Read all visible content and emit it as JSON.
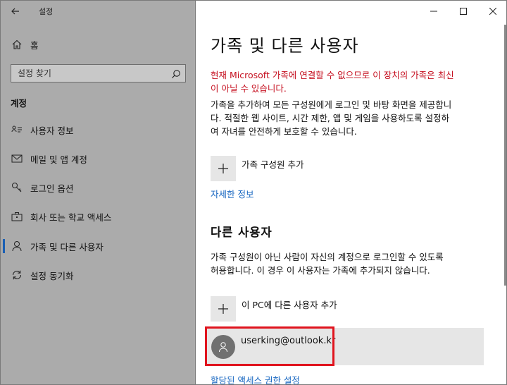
{
  "window": {
    "title": "설정",
    "controls": {
      "minimize": "—",
      "maximize": "☐",
      "close": "✕"
    }
  },
  "sidebar": {
    "home_label": "홈",
    "search_placeholder": "설정 찾기",
    "section_label": "계정",
    "items": [
      {
        "label": "사용자 정보",
        "icon": "user-card-icon",
        "active": false
      },
      {
        "label": "메일 및 앱 계정",
        "icon": "mail-icon",
        "active": false
      },
      {
        "label": "로그인 옵션",
        "icon": "key-icon",
        "active": false
      },
      {
        "label": "회사 또는 학교 액세스",
        "icon": "briefcase-icon",
        "active": false
      },
      {
        "label": "가족 및 다른 사용자",
        "icon": "person-icon",
        "active": true
      },
      {
        "label": "설정 동기화",
        "icon": "sync-icon",
        "active": false
      }
    ]
  },
  "main": {
    "title": "가족 및 다른 사용자",
    "error_line1": "현재 Microsoft 가족에 연결할 수 없으므로 이 장치의 가족은 최신",
    "error_line2": "이 아닐 수 있습니다.",
    "desc_line1": "가족을 추가하여 모든 구성원에게 로그인 및 바탕 화면을 제공합니",
    "desc_line2": "다. 적절한 웹 사이트, 시간 제한, 앱 및 게임을 사용하도록 설정하",
    "desc_line3": "여 자녀를 안전하게 보호할 수 있습니다.",
    "add_family_label": "가족 구성원 추가",
    "more_info_link": "자세한 정보",
    "other_users_heading": "다른 사용자",
    "other_desc_line1": "가족 구성원이 아닌 사람이 자신의 계정으로 로그인할 수 있도록",
    "other_desc_line2": "허용합니다. 이 경우 이 사용자는 가족에 추가되지 않습니다.",
    "add_other_label": "이 PC에 다른 사용자 추가",
    "user_email": "userking@outlook.kr",
    "assigned_access_link": "할당된 액세스 권한 설정"
  },
  "colors": {
    "sidebar_bg": "#ababab",
    "accent": "#1565c0",
    "error": "#c50f1f",
    "highlight": "#e0141e"
  }
}
